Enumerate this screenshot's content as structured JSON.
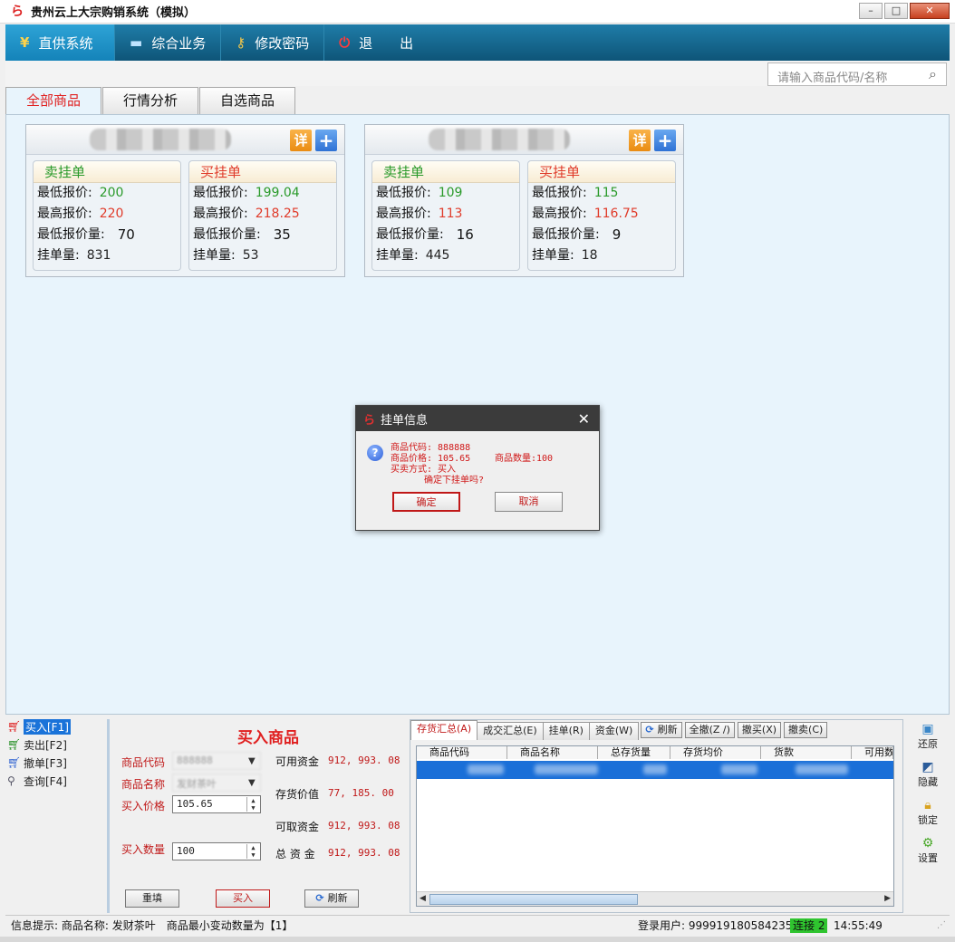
{
  "window": {
    "title": "贵州云上大宗购销系统（模拟）",
    "controls": [
      "minimize-icon",
      "maximize-icon",
      "close-icon"
    ]
  },
  "nav": {
    "items": [
      {
        "label": "直供系统",
        "icon": "yen-icon",
        "active": true
      },
      {
        "label": "综合业务",
        "icon": "monitor-icon"
      },
      {
        "label": "修改密码",
        "icon": "key-icon"
      },
      {
        "label": "退　　出",
        "icon": "power-icon"
      }
    ]
  },
  "search": {
    "placeholder": "请输入商品代码/名称"
  },
  "tabs": [
    "全部商品",
    "行情分析",
    "自选商品"
  ],
  "cards": [
    {
      "detail_label": "详",
      "add_label": "+",
      "sell": {
        "title": "卖挂单",
        "min_price_label": "最低报价:",
        "min_price": "200",
        "max_price_label": "最高报价:",
        "max_price": "220",
        "min_qty_label": "最低报价量:",
        "min_qty": "70",
        "volume_label": "挂单量:",
        "volume": "831"
      },
      "buy": {
        "title": "买挂单",
        "min_price_label": "最低报价:",
        "min_price": "199.04",
        "max_price_label": "最高报价:",
        "max_price": "218.25",
        "min_qty_label": "最低报价量:",
        "min_qty": "35",
        "volume_label": "挂单量:",
        "volume": "53"
      }
    },
    {
      "detail_label": "详",
      "add_label": "+",
      "sell": {
        "title": "卖挂单",
        "min_price_label": "最低报价:",
        "min_price": "109",
        "max_price_label": "最高报价:",
        "max_price": "113",
        "min_qty_label": "最低报价量:",
        "min_qty": "16",
        "volume_label": "挂单量:",
        "volume": "445"
      },
      "buy": {
        "title": "买挂单",
        "min_price_label": "最低报价:",
        "min_price": "115",
        "max_price_label": "最高报价:",
        "max_price": "116.75",
        "min_qty_label": "最低报价量:",
        "min_qty": "9",
        "volume_label": "挂单量:",
        "volume": "18"
      }
    }
  ],
  "dialog": {
    "title": "挂单信息",
    "code_line": "商品代码: 888888",
    "price_line": "商品价格: 105.65",
    "qty_line": "商品数量:100",
    "mode_line": "买卖方式: 买入",
    "confirm_line": "确定下挂单吗?",
    "ok": "确定",
    "cancel": "取消"
  },
  "side_menu": [
    {
      "label": "买入[F1]",
      "icon": "cart-buy-icon",
      "active": true
    },
    {
      "label": "卖出[F2]",
      "icon": "cart-sell-icon"
    },
    {
      "label": "撤单[F3]",
      "icon": "cart-cancel-icon"
    },
    {
      "label": "查询[F4]",
      "icon": "search-icon"
    }
  ],
  "order_form": {
    "title": "买入商品",
    "code_label": "商品代码",
    "code_value": "888888",
    "name_label": "商品名称",
    "name_value": "发财茶叶",
    "price_label": "买入价格",
    "price_value": "105.65",
    "qty_label": "买入数量",
    "qty_value": "100",
    "available_label": "可用资金",
    "available_value": "912, 993. 08",
    "stock_label": "存货价值",
    "stock_value": "77, 185. 00",
    "withdraw_label": "可取资金",
    "withdraw_value": "912, 993. 08",
    "total_label": "总 资 金",
    "total_value": "912, 993. 08",
    "reset_btn": "重填",
    "buy_btn": "买入",
    "refresh_btn": "刷新"
  },
  "grid": {
    "tabs": [
      "存货汇总(A)",
      "成交汇总(E)",
      "挂单(R)",
      "资金(W)"
    ],
    "tools": [
      "刷新",
      "全撤(Z /)",
      "撤买(X)",
      "撤卖(C)"
    ],
    "columns": [
      "商品代码",
      "商品名称",
      "总存货量",
      "存货均价",
      "货款",
      "可用数"
    ]
  },
  "right_tools": [
    {
      "label": "还原",
      "icon": "restore-icon"
    },
    {
      "label": "隐藏",
      "icon": "hide-icon"
    },
    {
      "label": "锁定",
      "icon": "lock-icon"
    },
    {
      "label": "设置",
      "icon": "gear-icon"
    }
  ],
  "status": {
    "hint": "信息提示: 商品名称: 发财茶叶　商品最小变动数量为【1】",
    "user": "登录用户: 999919180584235",
    "connection": "连接 2",
    "time": "14:55:49"
  }
}
